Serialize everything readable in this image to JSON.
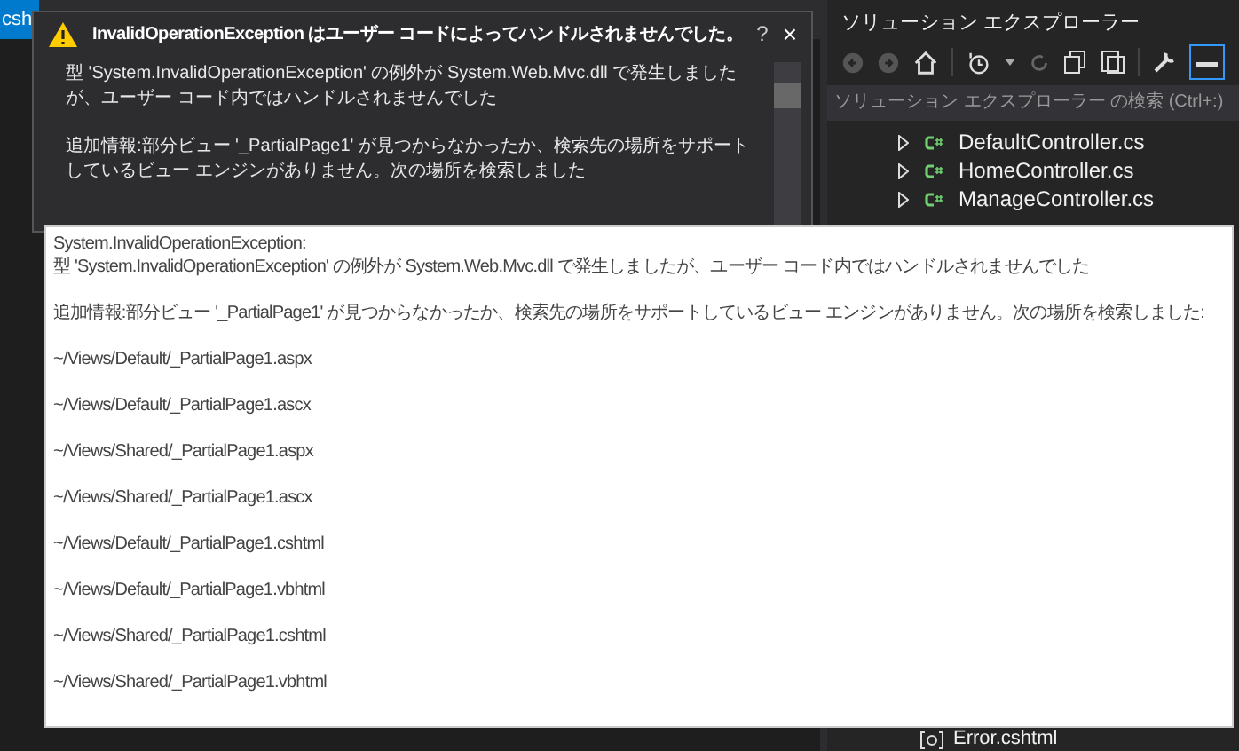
{
  "editor_tabs": [
    {
      "label": "csh",
      "selected": true
    }
  ],
  "exception_popup": {
    "title": "InvalidOperationException はユーザー コードによってハンドルされませんでした。",
    "help": "?",
    "close": "×",
    "paragraphs": [
      "型 'System.InvalidOperationException' の例外が System.Web.Mvc.dll で発生しましたが、ユーザー コード内ではハンドルされませんでした",
      "追加情報:部分ビュー '_PartialPage1' が見つからなかったか、検索先の場所をサポートしているビュー エンジンがありません。次の場所を検索しました"
    ]
  },
  "tooltip": {
    "paragraphs": [
      [
        "System.InvalidOperationException:",
        "型 'System.InvalidOperationException' の例外が System.Web.Mvc.dll で発生しましたが、ユーザー コード内ではハンドルされませんでした"
      ],
      [
        "追加情報:部分ビュー '_PartialPage1' が見つからなかったか、検索先の場所をサポートしているビュー エンジンがありません。次の場所を検索しました:"
      ],
      [
        "~/Views/Default/_PartialPage1.aspx"
      ],
      [
        "~/Views/Default/_PartialPage1.ascx"
      ],
      [
        "~/Views/Shared/_PartialPage1.aspx"
      ],
      [
        "~/Views/Shared/_PartialPage1.ascx"
      ],
      [
        "~/Views/Default/_PartialPage1.cshtml"
      ],
      [
        "~/Views/Default/_PartialPage1.vbhtml"
      ],
      [
        "~/Views/Shared/_PartialPage1.cshtml"
      ],
      [
        "~/Views/Shared/_PartialPage1.vbhtml"
      ]
    ]
  },
  "solution_explorer": {
    "title": "ソリューション エクスプローラー",
    "search": {
      "placeholder": "ソリューション エクスプローラー の検索 (Ctrl+:)"
    },
    "items": [
      {
        "label": "DefaultController.cs",
        "kind": "cs"
      },
      {
        "label": "HomeController.cs",
        "kind": "cs"
      },
      {
        "label": "ManageController.cs",
        "kind": "cs"
      }
    ],
    "bottom_items": [
      {
        "label": "Error.cshtml",
        "kind": "razor"
      }
    ]
  }
}
